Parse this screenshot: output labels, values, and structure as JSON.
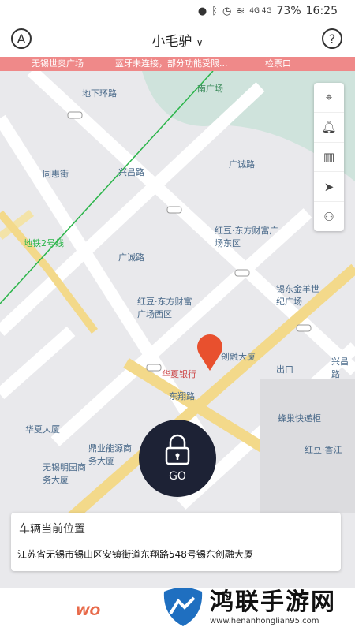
{
  "status_bar": {
    "network": "4G 4G",
    "battery": "73%",
    "time": "16:25"
  },
  "header": {
    "title": "小毛驴",
    "left_button": "A",
    "right_button": "?"
  },
  "banner": {
    "left_text": "无锡世奥广场",
    "message": "蓝牙未连接，部分功能受限...",
    "right_text": "检票口"
  },
  "map_labels": {
    "south_square": "南广场",
    "dixia_huanlu": "地下环路",
    "tonghui_street": "同惠街",
    "xingchang_road": "兴昌路",
    "guangcheng_road1": "广诚路",
    "guangcheng_road2": "广诚路",
    "hongdou_east": "红豆·东方财富广场东区",
    "hongdou_west": "红豆·东方财富广场西区",
    "xidong_jinyang": "锡东金羊世纪广场",
    "chuangrong": "创融大厦",
    "huaxia_bank": "华夏银行",
    "dongxiang_road": "东翔路",
    "exit": "出口",
    "huaxia_building": "华夏大厦",
    "fengchao": "蜂巢快递柜",
    "hongdou_xiangjiang": "红豆·香江",
    "wuxi_mingyuan": "无锡明园商务大厦",
    "dingye": "鼎业能源商务大厦",
    "metro_line": "地铁2号线",
    "xingchang_road2": "兴昌路"
  },
  "toolbar": {
    "items": [
      "locate-icon",
      "bell-icon",
      "chart-icon",
      "navigate-icon",
      "scooter-icon"
    ]
  },
  "lock_button": {
    "label": "GO"
  },
  "location_card": {
    "title": "车辆当前位置",
    "address": "江苏省无锡市锡山区安镇街道东翔路548号锡东创融大厦"
  },
  "bottom": {
    "logo": "WO"
  },
  "watermark": {
    "text": "鸿联手游网",
    "url": "www.henanhonglian95.com"
  }
}
